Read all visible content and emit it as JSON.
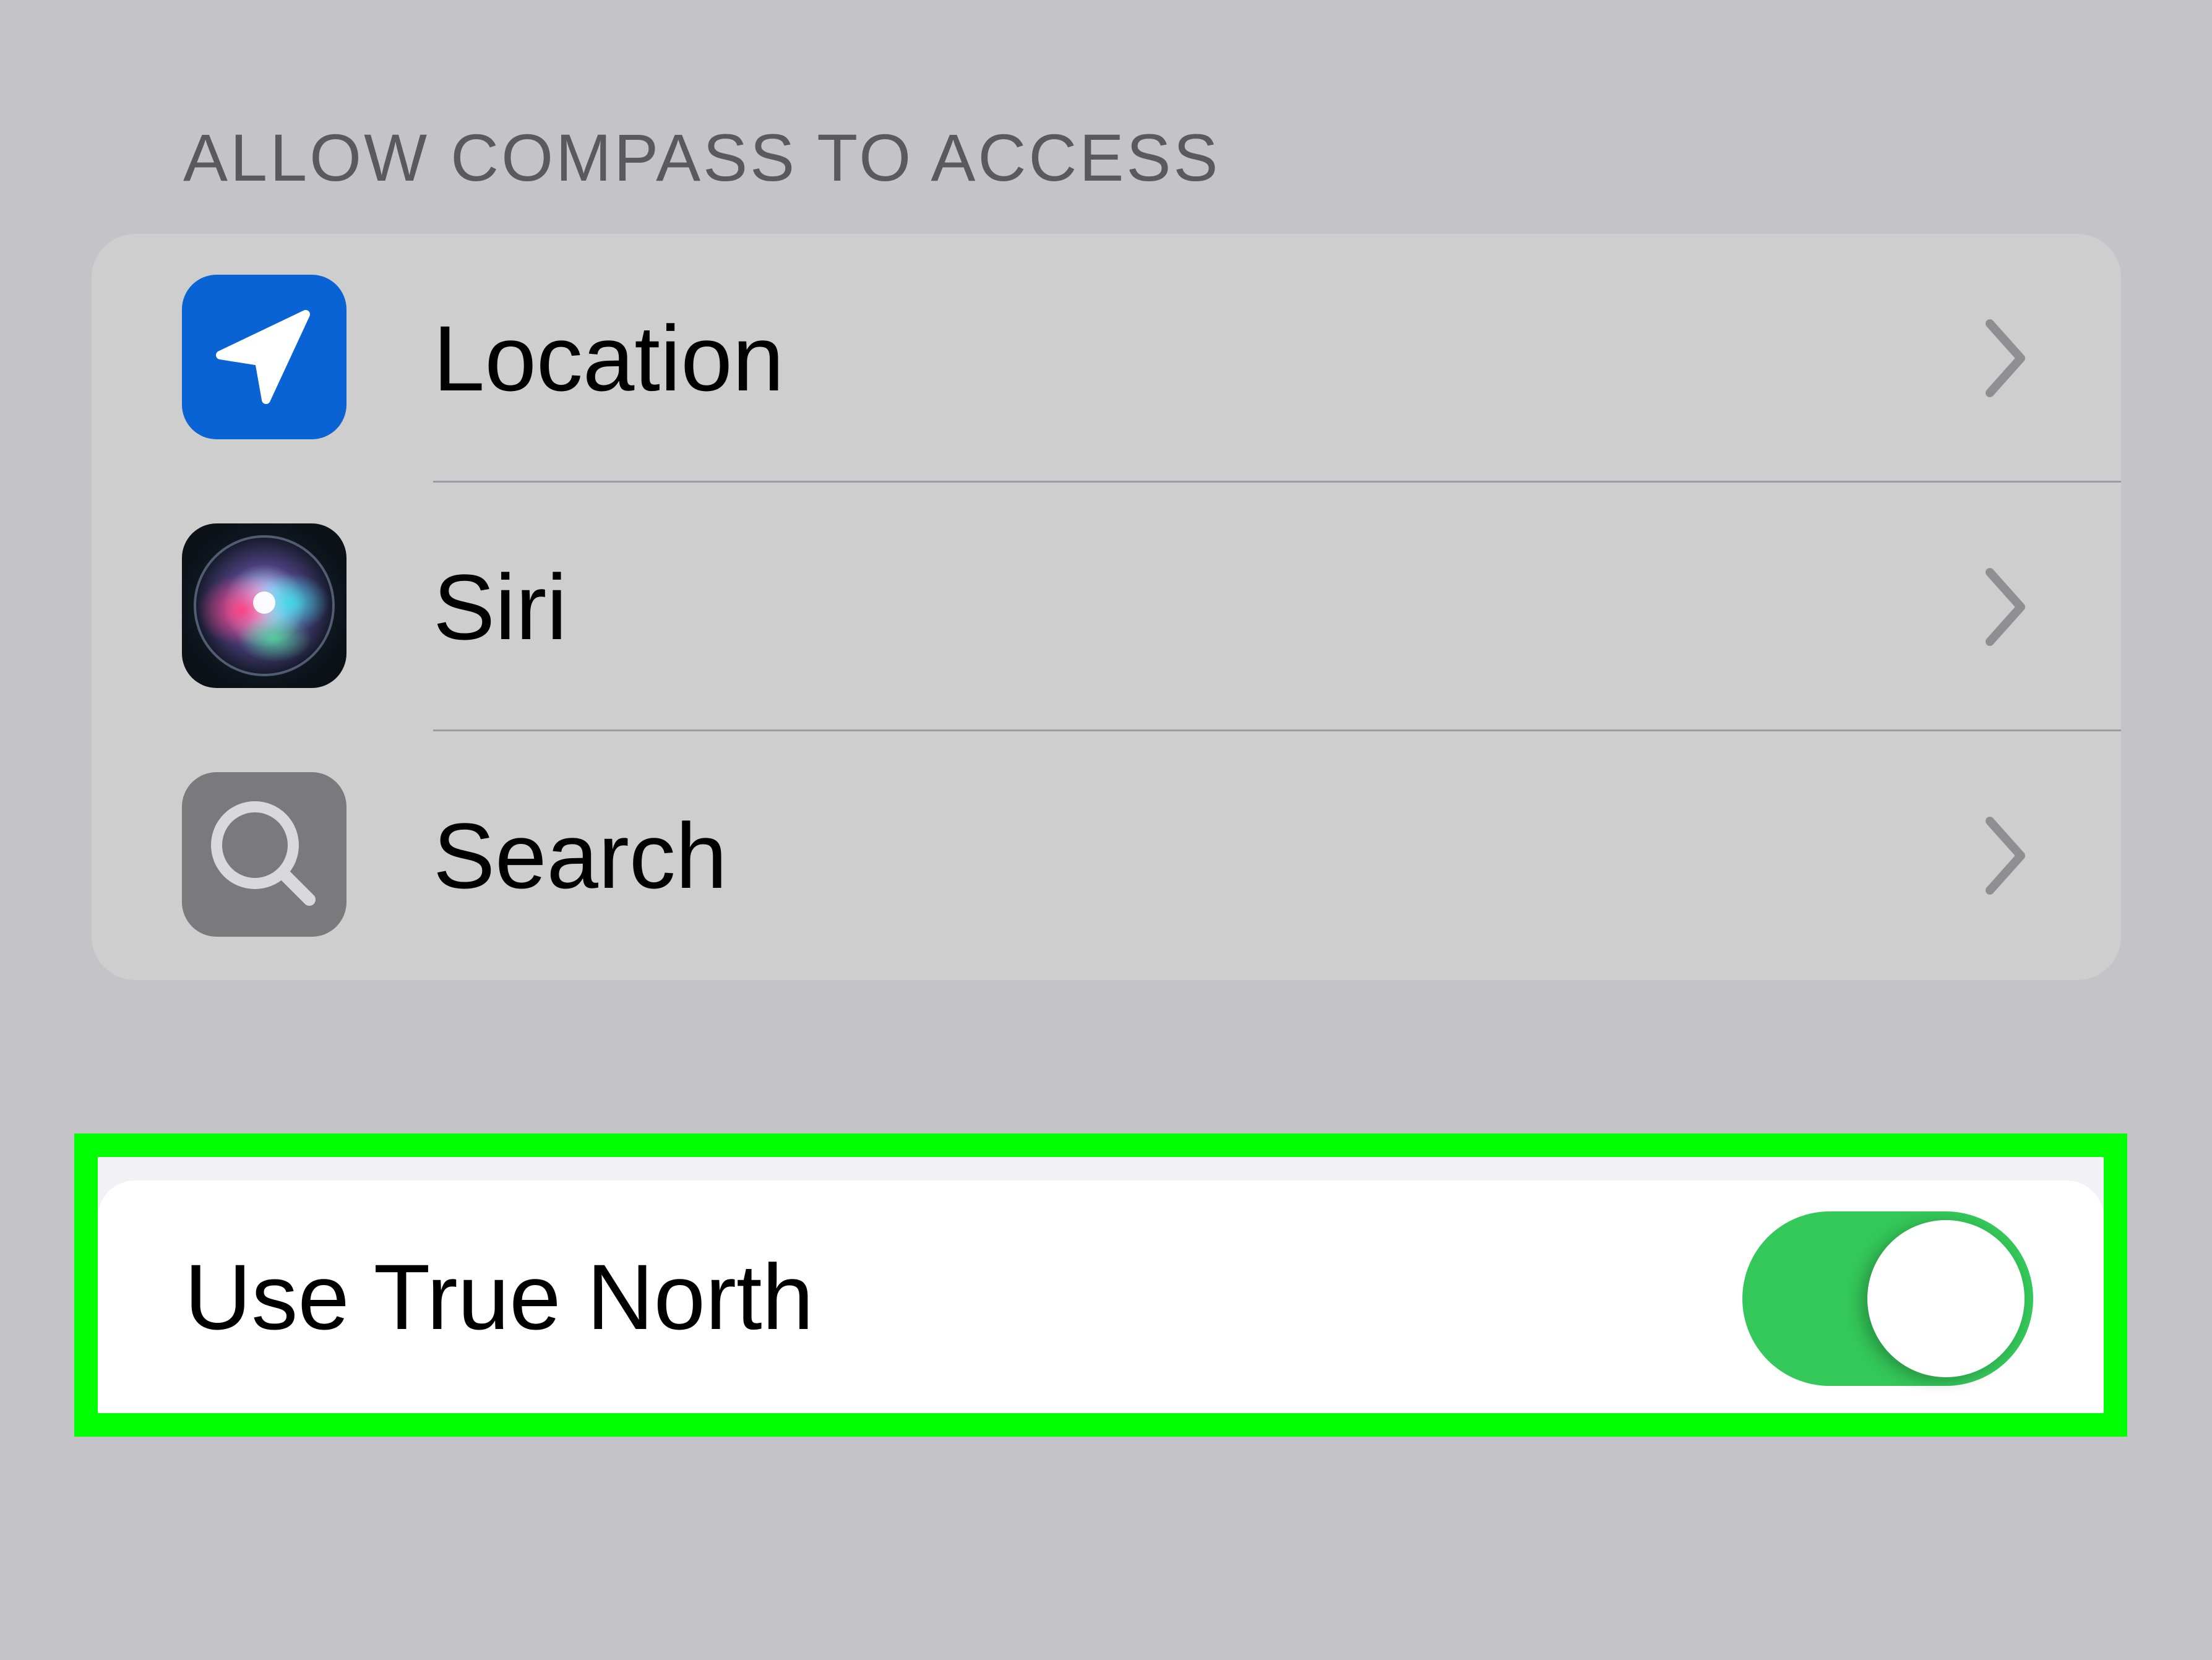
{
  "section": {
    "header": "ALLOW COMPASS TO ACCESS",
    "items": [
      {
        "label": "Location",
        "icon": "location-arrow-icon",
        "icon_color": "#0a63d4"
      },
      {
        "label": "Siri",
        "icon": "siri-icon",
        "icon_color": "#0c1118"
      },
      {
        "label": "Search",
        "icon": "magnifying-glass-icon",
        "icon_color": "#7a7a7d"
      }
    ]
  },
  "true_north": {
    "label": "Use True North",
    "enabled": true,
    "switch_color": "#34c759"
  },
  "highlight_color": "#00ff00"
}
